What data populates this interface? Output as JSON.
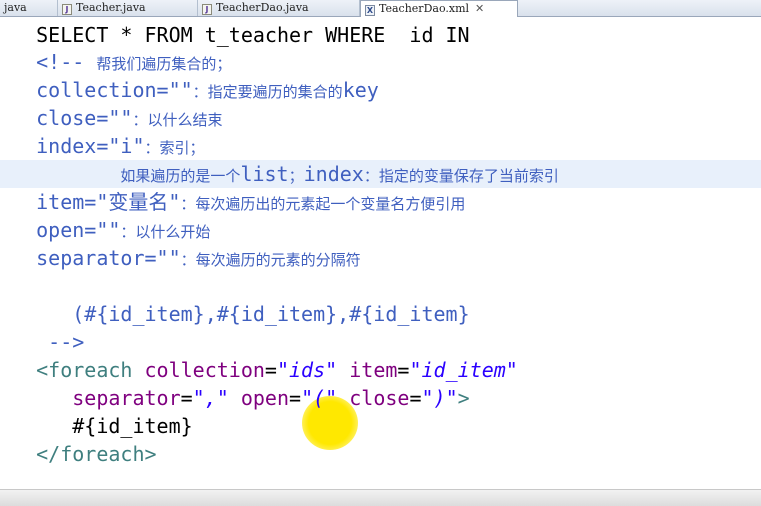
{
  "tabs": [
    {
      "label": "java",
      "icon": "none",
      "active": false
    },
    {
      "label": "Teacher.java",
      "icon": "java-file-icon",
      "active": false
    },
    {
      "label": "TeacherDao.java",
      "icon": "java-file-icon",
      "active": false
    },
    {
      "label": "TeacherDao.xml",
      "icon": "xml-file-icon",
      "active": true,
      "close": "✕"
    }
  ],
  "code": {
    "sql": "SELECT * FROM t_teacher WHERE  id IN",
    "c1_open": "<!-- ",
    "c1_text": "帮我们遍历集合的；",
    "c2_code": "collection=\"\"",
    "c2_text": "：指定要遍历的集合的",
    "c2_key": "key",
    "c3_code": "close=\"\"",
    "c3_text": "：以什么结束",
    "c4_code": "index=\"i\"",
    "c4_text": "：索引；",
    "c5_a": "如果遍历的是一个",
    "c5_b": "list",
    "c5_c": "；",
    "c5_d": "index",
    "c5_e": "：指定的变量保存了当前索引",
    "c6_code": "item=\"变量名\"",
    "c6_text": "：每次遍历出的元素起一个变量名方便引用",
    "c7_code": "open=\"\"",
    "c7_text": "：以什么开始",
    "c8_code": "separator=\"\"",
    "c8_text": "：每次遍历的元素的分隔符",
    "c9": "(#{id_item},#{id_item},#{id_item}",
    "c10": "-->",
    "t1_open": "<foreach",
    "t1_attr1": "collection",
    "t1_eq1": "=",
    "t1_val1": "\"ids\"",
    "t1_attr2": "item",
    "t1_eq2": "=",
    "t1_val2": "\"id_item\"",
    "t2_attr1": "separator",
    "t2_eq1": "=",
    "t2_val1": "\",\"",
    "t2_attr2": "open",
    "t2_eq2": "=",
    "t2_val2": "\"(\"",
    "t2_attr3": "close",
    "t2_eq3": "=",
    "t2_val3": "\")\"",
    "t2_end": ">",
    "t3": "#{id_item}",
    "t4": "</foreach>"
  },
  "colors": {
    "comment": "#3f5fbf",
    "tag": "#3f7f7f",
    "attr": "#7f007f",
    "value": "#2a00ff",
    "highlight": "#e8f0fb",
    "cursor": "#ffe800"
  }
}
